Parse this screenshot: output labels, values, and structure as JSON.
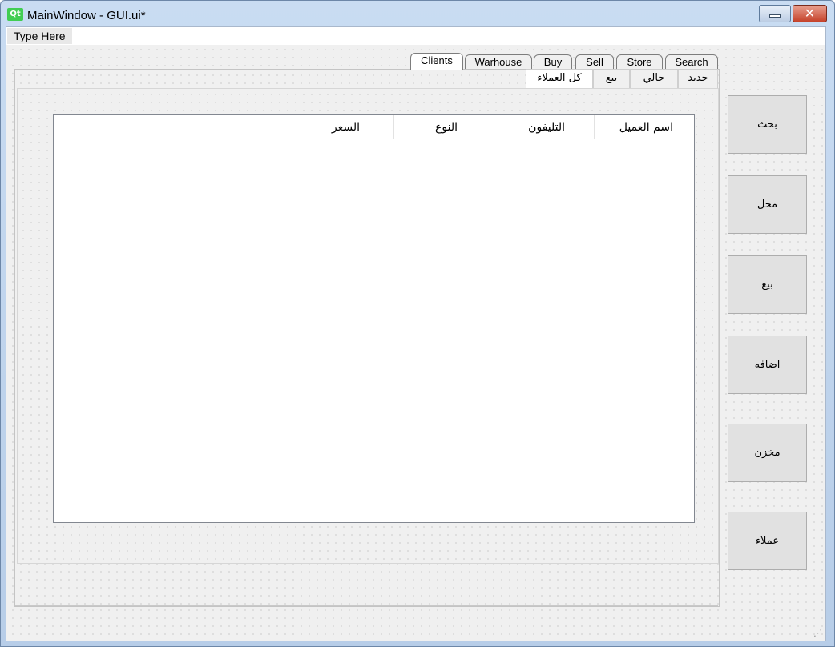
{
  "window": {
    "title": "MainWindow - GUI.ui*",
    "logo_text": "Qt",
    "minimize_icon": "minimize-icon",
    "close_icon": "close-icon",
    "close_glyph": "✕"
  },
  "menubar": {
    "placeholder_item": "Type Here"
  },
  "main_tabs": [
    {
      "label": "Clients",
      "active": true
    },
    {
      "label": "Warhouse",
      "active": false
    },
    {
      "label": "Buy",
      "active": false
    },
    {
      "label": "Sell",
      "active": false
    },
    {
      "label": "Store",
      "active": false
    },
    {
      "label": "Search",
      "active": false
    }
  ],
  "sub_tabs": [
    {
      "label": "كل العملاء",
      "active": true
    },
    {
      "label": "بيع",
      "active": false
    },
    {
      "label": "حالي",
      "active": false
    },
    {
      "label": "جديد",
      "active": false
    }
  ],
  "table": {
    "columns": [
      "اسم العميل",
      "التليفون",
      "النوع",
      "السعر"
    ],
    "rows": []
  },
  "side_buttons": [
    "بحث",
    "محل",
    "بيع",
    "اضافه",
    "مخزن",
    "عملاء"
  ],
  "colors": {
    "qt_green": "#41cd52",
    "close_red": "#c5422a",
    "title_bar": "#c9dcf2"
  }
}
